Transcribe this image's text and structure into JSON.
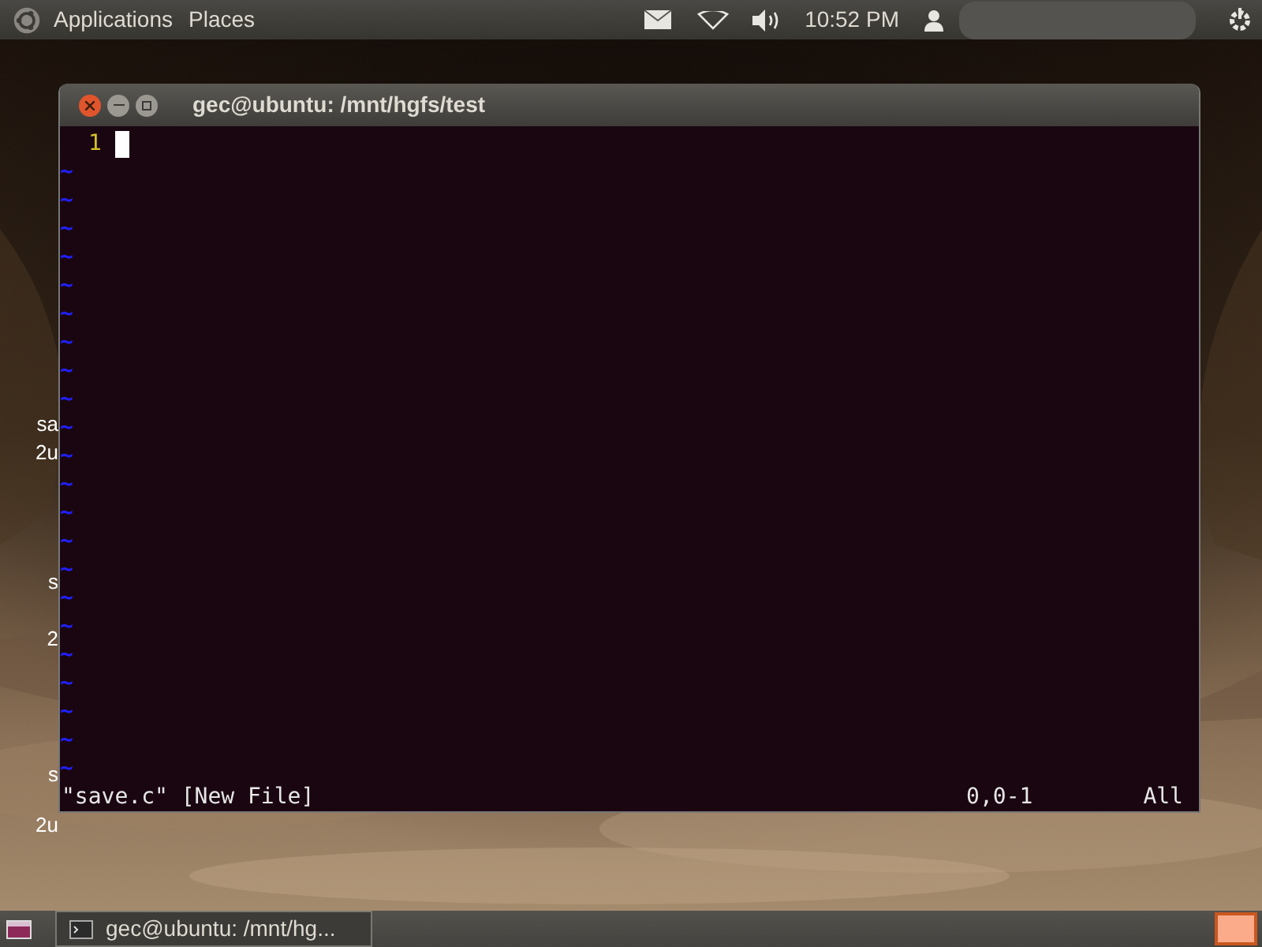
{
  "top_panel": {
    "menus": [
      "Applications",
      "Places"
    ],
    "clock": "10:52 PM"
  },
  "desktop_labels": [
    {
      "text": "sa"
    },
    {
      "text": "2u"
    },
    {
      "text": "s"
    },
    {
      "text": "2"
    },
    {
      "text": "s"
    },
    {
      "text": "2u"
    }
  ],
  "window": {
    "title": "gec@ubuntu: /mnt/hgfs/test",
    "lines": [
      {
        "number": "1"
      }
    ],
    "empty_lines": [
      "~",
      "~",
      "~",
      "~",
      "~",
      "~",
      "~",
      "~",
      "~",
      "~",
      "~",
      "~",
      "~",
      "~",
      "~",
      "~",
      "~",
      "~",
      "~",
      "~",
      "~",
      "~"
    ],
    "status_line": {
      "message": "\"save.c\" [New File]",
      "position": "0,0-1",
      "scroll": "All"
    }
  },
  "bottom_panel": {
    "tasks": [
      {
        "label": "gec@ubuntu: /mnt/hg...",
        "selected": false
      }
    ]
  }
}
